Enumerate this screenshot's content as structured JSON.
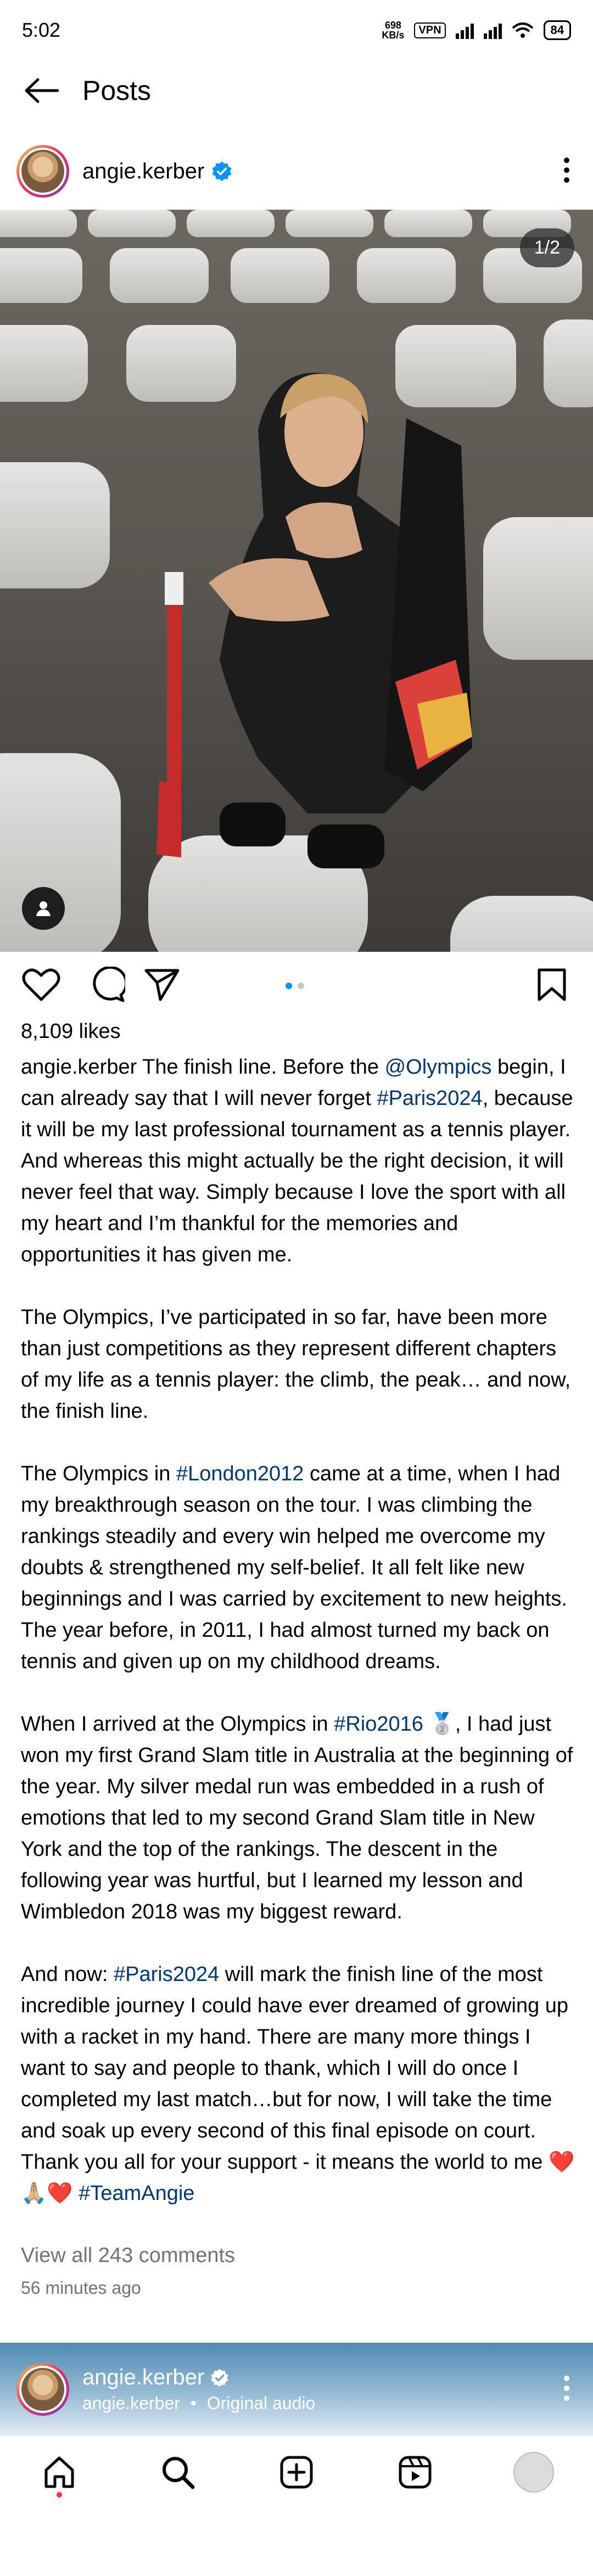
{
  "status_bar": {
    "time": "5:02",
    "speed_value": "698",
    "speed_unit": "KB/s",
    "vpn": "VPN",
    "battery": "84"
  },
  "header": {
    "title": "Posts"
  },
  "post": {
    "username": "angie.kerber",
    "image_counter": "1/2",
    "likes": "8,109 likes",
    "caption": [
      [
        {
          "t": "angie.kerber ",
          "k": "user"
        },
        {
          "t": "The finish line. Before the ",
          "k": "text"
        },
        {
          "t": "@Olympics",
          "k": "link"
        },
        {
          "t": " begin, I can already say that I will never forget ",
          "k": "text"
        },
        {
          "t": "#Paris2024",
          "k": "link"
        },
        {
          "t": ", because it will be my last professional tournament as a tennis player. And whereas this might actually be the right decision, it will never feel that way. Simply because I love the sport with all my heart and I’m thankful for the memories and opportunities it has given me.",
          "k": "text"
        }
      ],
      [
        {
          "t": "The Olympics, I’ve participated in so far, have been more than just competitions as they represent different chapters of my life as a tennis player: the climb, the peak… and now, the finish line.",
          "k": "text"
        }
      ],
      [
        {
          "t": "The Olympics in ",
          "k": "text"
        },
        {
          "t": "#London2012",
          "k": "link"
        },
        {
          "t": " came at a time, when I had my breakthrough season on the tour. I was climbing the rankings steadily and every win helped me overcome my doubts & strengthened my self-belief. It all felt like new beginnings and I was carried by excitement to new heights. The year before, in 2011, I had almost turned my back on tennis and given up on my childhood dreams.",
          "k": "text"
        }
      ],
      [
        {
          "t": "When I arrived at the Olympics in ",
          "k": "text"
        },
        {
          "t": "#Rio2016",
          "k": "link"
        },
        {
          "t": " 🥈, I had just won my first Grand Slam title in Australia at the beginning of the year. My silver medal run was embedded in a rush of emotions that led to my second Grand Slam title in New York and the top of the rankings. The descent in the following year was hurtful, but I learned my lesson and Wimbledon 2018 was my biggest reward.",
          "k": "text"
        }
      ],
      [
        {
          "t": "And now: ",
          "k": "text"
        },
        {
          "t": "#Paris2024",
          "k": "link"
        },
        {
          "t": " will mark the finish line of the most incredible journey I could have ever dreamed of growing up with a racket in my hand. There are many more things I want to say and people to thank, which I will do once I completed my last match…but for now, I will take the time and soak up every second of this final episode on court. Thank you all for your support - it means the world to me ❤️🙏🏼❤️ ",
          "k": "text"
        },
        {
          "t": "#TeamAngie",
          "k": "link"
        }
      ]
    ],
    "view_comments": "View all 243 comments",
    "time_ago": "56 minutes ago",
    "carousel": {
      "count": 2,
      "active": 0
    }
  },
  "next_post": {
    "username": "angie.kerber",
    "audio_user": "angie.kerber",
    "separator": "•",
    "audio_label": "Original audio"
  },
  "colors": {
    "verified": "#0095f6",
    "link": "#00376b",
    "dot_active": "#0095f6",
    "secondary_text": "#737373"
  },
  "icons": {
    "back": "arrow-left-icon",
    "more": "more-vertical-icon",
    "like": "heart-icon",
    "comment": "comment-bubble-icon",
    "share": "send-icon",
    "save": "bookmark-icon",
    "tag": "person-tag-icon",
    "home": "home-icon",
    "search": "search-icon",
    "create": "plus-square-icon",
    "reels": "reels-icon",
    "profile": "profile-avatar-icon"
  }
}
